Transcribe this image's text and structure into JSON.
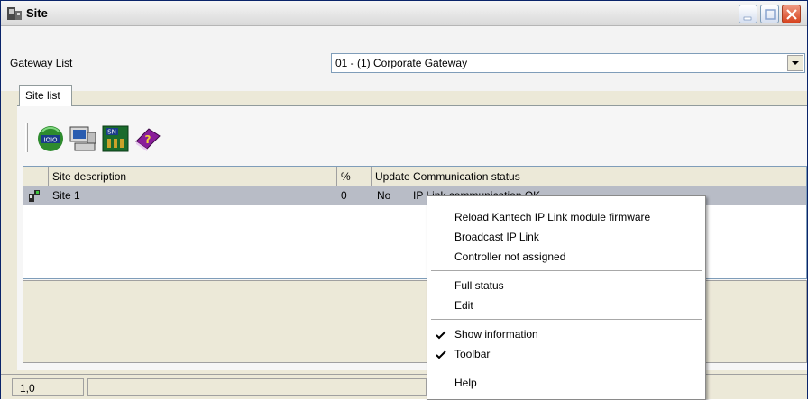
{
  "window": {
    "title": "Site"
  },
  "gateway": {
    "label": "Gateway List",
    "selected": "01 - (1) Corporate Gateway"
  },
  "tabs": [
    {
      "label": "Site list"
    }
  ],
  "toolbar": {
    "tools": [
      "connect-io-icon",
      "computer-monitor-icon",
      "sn-board-icon",
      "help-book-icon"
    ],
    "tool3_text": "SN"
  },
  "grid": {
    "columns": [
      "Site description",
      "%",
      "Update",
      "Communication status"
    ],
    "rows": [
      {
        "description": "Site 1",
        "percent": "0",
        "update": "No",
        "status": "IP Link communication OK"
      }
    ]
  },
  "statusbar": {
    "position": "1,0"
  },
  "context_menu": {
    "group1": [
      "Reload Kantech IP Link module firmware",
      "Broadcast IP Link",
      "Controller not assigned"
    ],
    "group2": [
      "Full status",
      "Edit"
    ],
    "group3": [
      {
        "label": "Show information",
        "checked": true
      },
      {
        "label": "Toolbar",
        "checked": true
      }
    ],
    "group4": [
      "Help"
    ]
  },
  "colors": {
    "selection": "#b8bcc6",
    "window_bg": "#ece9d8"
  }
}
